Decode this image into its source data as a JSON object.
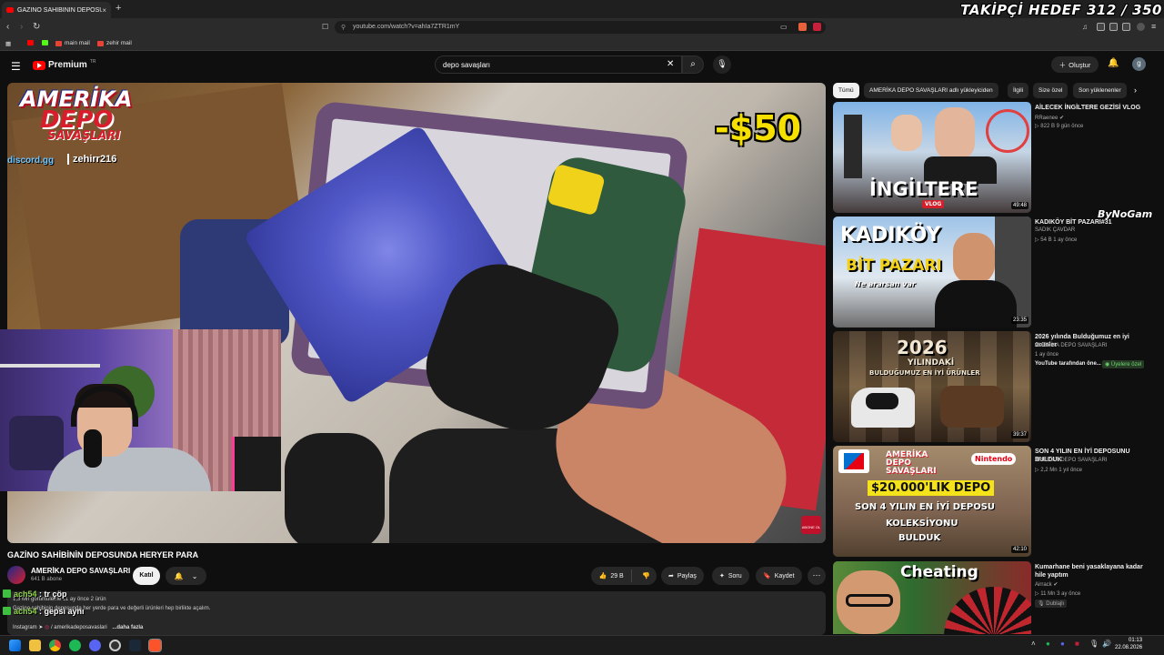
{
  "browser": {
    "tab_title": "GAZİNO SAHİBİNİN DEPOSUND",
    "tab_close": "×",
    "new_tab": "+",
    "url": "youtube.com/watch?v=ahIa7ZTR1mY",
    "bookmarks": [
      {
        "label": "",
        "color": "#ff0000"
      },
      {
        "label": "",
        "color": "#53fc18"
      },
      {
        "label": "main mail",
        "color": "#ea4335"
      },
      {
        "label": "zehir mail",
        "color": "#ea4335"
      }
    ]
  },
  "stream_overlay": {
    "goal_text": "TAKİPÇİ HEDEF 312 / 350",
    "watermark": "ByNoGam",
    "chat": [
      {
        "user": "ach54",
        "message": "tr çöp"
      },
      {
        "user": "ach54",
        "message": "gepsi aynı"
      }
    ]
  },
  "youtube": {
    "logo_text": "Premium",
    "logo_region": "TR",
    "search_value": "depo savaşları",
    "create_label": "Oluştur",
    "avatar_letter": "g"
  },
  "video": {
    "brand_line1": "AMERİKA",
    "brand_line2": "DEPO",
    "brand_line3": "SAVAŞLARI",
    "discord": "discord.gg",
    "handle": "zehirr216",
    "price_tag": "-$50",
    "subscribe_badge": "ABONE OL",
    "title": "GAZİNO SAHİBİNİN DEPOSUNDA HERYER PARA",
    "channel": "AMERİKA DEPO SAVAŞLARI",
    "subscribers": "641 B abone",
    "join_label": "Katıl",
    "likes": "29 B",
    "share_label": "Paylaş",
    "ask_label": "Soru",
    "save_label": "Kaydet",
    "description_meta": "1,3 Mn görüntüleme  11 ay önce  2 ürün",
    "description_text": "Gazino sahibinin deposunda her yerde para ve değerli ürünleri hep birlikte açalım.",
    "description_footer_instagram": "Instagram ➤",
    "description_footer_handle": "/ amerikadeposavaslari",
    "description_more": "...daha fazla"
  },
  "chips": [
    {
      "label": "Tümü",
      "active": true
    },
    {
      "label": "AMERİKA DEPO SAVAŞLARI adlı yükleyiciden",
      "active": false
    },
    {
      "label": "İlgili",
      "active": false
    },
    {
      "label": "Size özel",
      "active": false
    },
    {
      "label": "Son yüklenenler",
      "active": false
    }
  ],
  "recommendations": [
    {
      "title": "AİLECEK İNGİLTERE GEZİSİ VLOG",
      "channel": "RRaenee",
      "meta": "▷ 822 B  9 gün önce",
      "duration": "49:48",
      "thumb_text": "İNGİLTERE",
      "thumb_sub": "VLOG"
    },
    {
      "title": "KADIKÖY BİT PAZARI#31",
      "channel": "SADIK ÇAVDAR",
      "meta": "▷ 54 B  1 ay önce",
      "duration": "23:35",
      "thumb_text": "KADIKÖY",
      "thumb_sub": "BİT PAZARI",
      "thumb_sub2": "Ne ararsan var"
    },
    {
      "title": "2026 yılında Bulduğumuz en iyi ürünler",
      "channel": "AMERİKA DEPO SAVAŞLARI",
      "meta": "1 ay önce",
      "extra": "YouTube tarafından öne...",
      "badge": "Üyelere özel",
      "duration": "39:37",
      "thumb_text": "2026",
      "thumb_sub": "YILINDAKİ",
      "thumb_sub2": "BULDUĞUMUZ EN İYİ ÜRÜNLER"
    },
    {
      "title": "SON 4 YILIN EN İYİ DEPOSUNU BULDUK",
      "channel": "AMERİKA DEPO SAVAŞLARI",
      "meta": "▷ 2,2 Mn  1 yıl önce",
      "duration": "42:10",
      "thumb_text": "$20.000'LIK DEPO",
      "thumb_sub": "SON 4 YILIN EN İYİ DEPOSU",
      "thumb_sub2": "KOLEKSİYONU",
      "thumb_sub3": "BULDUK",
      "logo_left": "AMERİKA DEPO SAVAŞLARI",
      "logo_right": "Nintendo"
    },
    {
      "title": "Kumarhane beni yasaklayana kadar hile yaptım",
      "channel": "Airrack",
      "meta": "▷ 11 Mn  3 ay önce",
      "extra": "Dublajlı",
      "duration": "",
      "thumb_text": "Cheating"
    }
  ],
  "taskbar": {
    "time": "01:13",
    "date": "22.08.2026"
  },
  "colors": {
    "yt_red": "#ff0000",
    "background": "#0f0f0f",
    "chip": "#272727",
    "brand_red": "#d81e2c",
    "price_yellow": "#f5e000",
    "chat_user": "#8fd14f"
  }
}
